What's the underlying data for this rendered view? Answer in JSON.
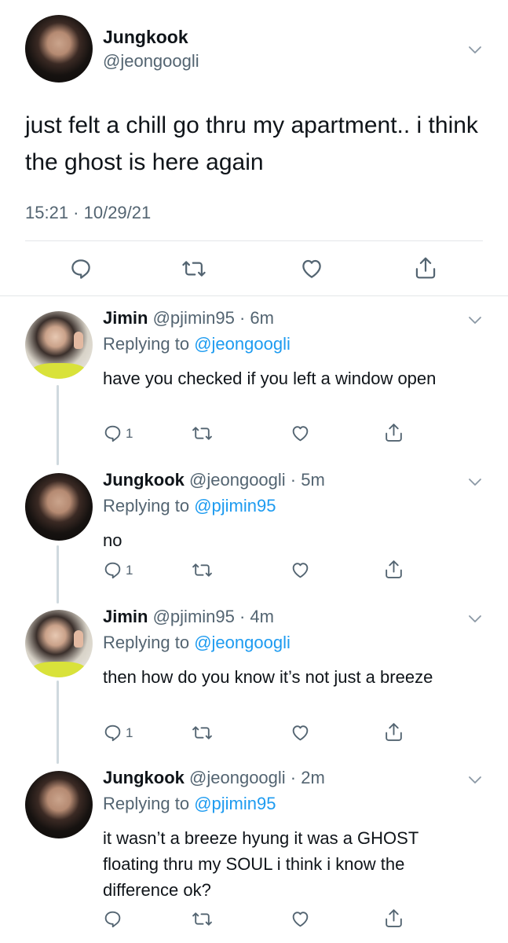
{
  "main_tweet": {
    "name": "Jungkook",
    "handle": "@jeongoogli",
    "text": "just felt a chill go thru my apartment.. i think the ghost is here again",
    "timestamp": "15:21 · 10/29/21"
  },
  "replies": [
    {
      "name": "Jimin",
      "handle_time": "@pjimin95 · 6m",
      "replying_prefix": "Replying to",
      "replying_to": "@jeongoogli",
      "text": "have you checked if you left a window open",
      "reply_count": "1"
    },
    {
      "name": "Jungkook",
      "handle_time": "@jeongoogli · 5m",
      "replying_prefix": "Replying to",
      "replying_to": "@pjimin95",
      "text": "no",
      "reply_count": "1"
    },
    {
      "name": "Jimin",
      "handle_time": "@pjimin95 · 4m",
      "replying_prefix": "Replying to",
      "replying_to": "@jeongoogli",
      "text": "then how do you know it’s not just a breeze",
      "reply_count": "1"
    },
    {
      "name": "Jungkook",
      "handle_time": "@jeongoogli · 2m",
      "replying_prefix": "Replying to",
      "replying_to": "@pjimin95",
      "text": "it wasn’t a breeze hyung it was a GHOST floating thru my SOUL i think i know the difference ok?",
      "reply_count": ""
    }
  ],
  "icons": [
    "reply-icon",
    "retweet-icon",
    "like-icon",
    "share-icon",
    "chevron-down-icon"
  ],
  "colors": {
    "link": "#1d9bf0",
    "secondary_text": "#536471",
    "divider": "#e3e6e9",
    "thread_line": "#cfd9de"
  }
}
